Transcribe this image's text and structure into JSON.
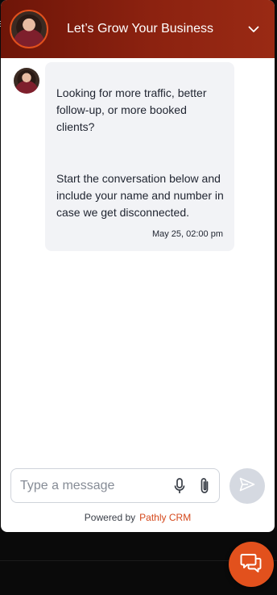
{
  "header": {
    "title": "Let’s Grow Your Business",
    "avatar_icon": "agent-avatar",
    "collapse_icon": "chevron-down-icon",
    "gradient_start": "#6e1508",
    "gradient_end": "#9a2a14"
  },
  "conversation": {
    "messages": [
      {
        "paragraphs": [
          "Looking for more traffic, better follow-up, or more booked clients?",
          "Start the conversation below and include your name and number in case we get disconnected."
        ],
        "timestamp": "May 25, 02:00 pm"
      }
    ]
  },
  "composer": {
    "placeholder": "Type a message",
    "value": "",
    "mic_icon": "microphone-icon",
    "attach_icon": "paperclip-icon",
    "send_icon": "send-icon"
  },
  "footer": {
    "powered_by": "Powered by",
    "brand": "Pathly CRM",
    "brand_color": "#d4471a"
  },
  "launcher": {
    "icon": "chat-bubbles-icon",
    "color": "#e2511d"
  }
}
